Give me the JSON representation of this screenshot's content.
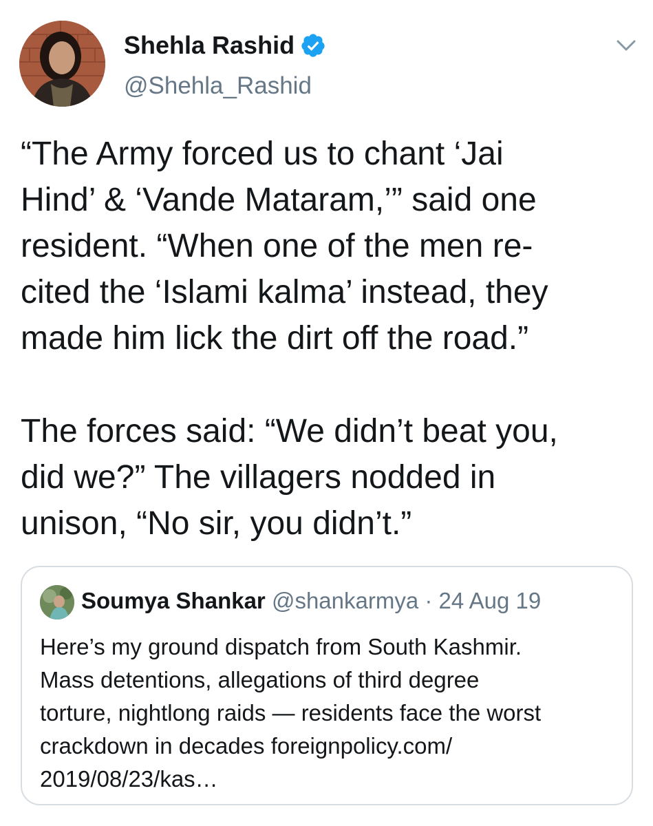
{
  "author": {
    "display_name": "Shehla Rashid",
    "handle": "@Shehla_Rashid",
    "verified": true
  },
  "tweet_text_lines": [
    "“The Army forced us to chant ‘Jai",
    "Hind’ & ‘Vande Mataram,’” said one",
    "resident. “When one of the men re-",
    "cited the ‘Islami kalma’ instead, they",
    "made him lick the dirt off the road.”",
    "",
    "The forces said: “We didn’t beat you,",
    "did we?” The villagers nodded in",
    "unison, “No sir, you didn’t.”"
  ],
  "quoted_tweet": {
    "display_name": "Soumya Shankar",
    "handle": "@shankarmya",
    "separator": "·",
    "date": "24 Aug 19",
    "text_lines": [
      "Here’s my ground dispatch from South Kashmir.",
      "Mass detentions, allegations of third degree",
      "torture, nightlong raids — residents face the worst",
      "crackdown in decades foreignpolicy.com/",
      "2019/08/23/kas…"
    ]
  },
  "icons": {
    "verified": "verified-badge-icon",
    "menu": "chevron-down-icon"
  },
  "colors": {
    "text_primary": "#14171a",
    "text_secondary": "#657786",
    "verified_blue": "#1da1f2",
    "border": "#d8dde2"
  }
}
